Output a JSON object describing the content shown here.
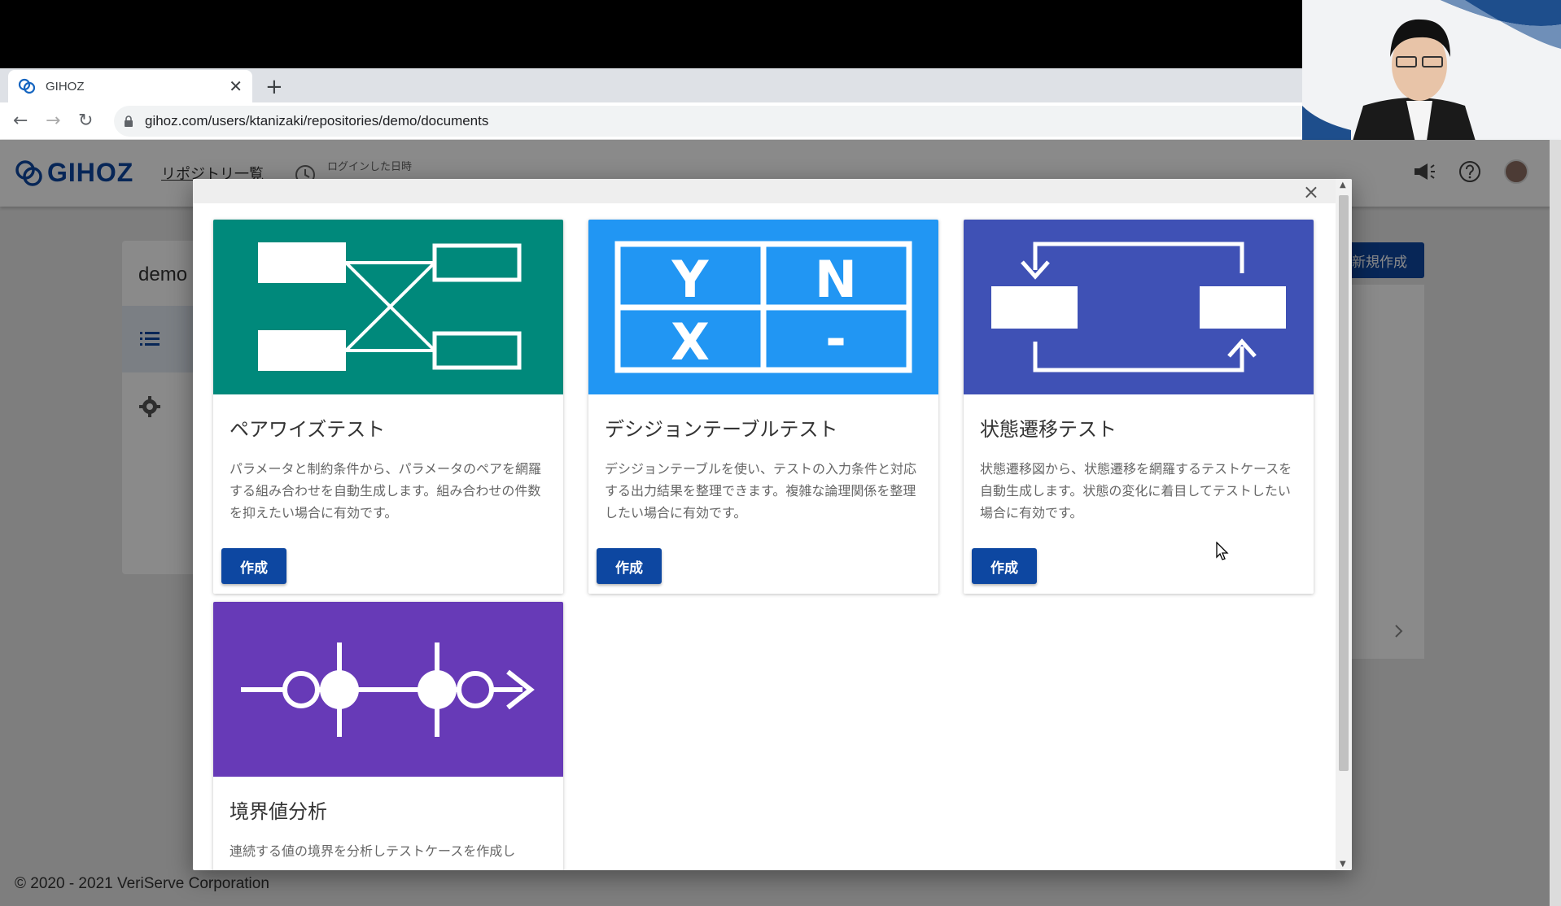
{
  "browser": {
    "tab_title": "GIHOZ",
    "tab_close": "✕",
    "new_tab": "+",
    "url": "gihoz.com/users/ktanizaki/repositories/demo/documents",
    "nav_back": "←",
    "nav_forward": "→",
    "nav_reload": "↻"
  },
  "app": {
    "logo_text": "GIHOZ",
    "nav_repositories": "リポジトリ一覧",
    "last_login_label": "ログインした日時",
    "repo_title": "demo",
    "new_button": "新規作成",
    "footer": "© 2020 - 2021 VeriServe Corporation"
  },
  "modal": {
    "close": "×",
    "cards": [
      {
        "title": "ペアワイズテスト",
        "description": "パラメータと制約条件から、パラメータのペアを網羅する組み合わせを自動生成します。組み合わせの件数を抑えたい場合に有効です。",
        "button": "作成",
        "color": "#00897b"
      },
      {
        "title": "デシジョンテーブルテスト",
        "description": "デシジョンテーブルを使い、テストの入力条件と対応する出力結果を整理できます。複雑な論理関係を整理したい場合に有効です。",
        "button": "作成",
        "color": "#2196f3",
        "image_labels": [
          "Y",
          "N",
          "X",
          "-"
        ]
      },
      {
        "title": "状態遷移テスト",
        "description": "状態遷移図から、状態遷移を網羅するテストケースを自動生成します。状態の変化に着目してテストしたい場合に有効です。",
        "button": "作成",
        "color": "#3f51b5"
      },
      {
        "title": "境界値分析",
        "description": "連続する値の境界を分析しテストケースを作成し",
        "color": "#673ab7"
      }
    ]
  }
}
